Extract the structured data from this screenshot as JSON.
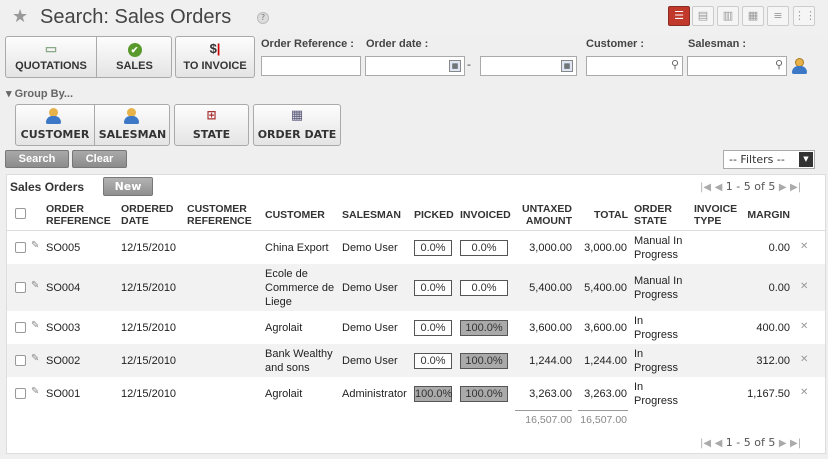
{
  "header": {
    "title": "Search: Sales Orders",
    "help": "?"
  },
  "views": [
    {
      "name": "list-view-icon",
      "glyph": "☰",
      "active": true
    },
    {
      "name": "page-view-icon",
      "glyph": "▤"
    },
    {
      "name": "graph-view-icon",
      "glyph": "▥"
    },
    {
      "name": "calendar-view-icon",
      "glyph": "▦"
    },
    {
      "name": "gantt-view-icon",
      "glyph": "≡"
    },
    {
      "name": "kanban-view-icon",
      "glyph": "⋮⋮"
    }
  ],
  "filters": {
    "quotations": "QUOTATIONS",
    "sales": "SALES",
    "to_invoice": "TO INVOICE",
    "customer": "CUSTOMER",
    "salesman": "SALESMAN",
    "state": "STATE",
    "order_date": "ORDER DATE"
  },
  "fields": {
    "order_reference": "Order Reference :",
    "order_date": "Order date :",
    "customer": "Customer :",
    "salesman": "Salesman :",
    "date_sep": "-"
  },
  "groupby_label": "▾ Group By...",
  "buttons": {
    "search": "Search",
    "clear": "Clear",
    "new": "New"
  },
  "filters_select": "-- Filters --",
  "list": {
    "title": "Sales Orders",
    "pager": "1 - 5 of 5",
    "columns": [
      "ORDER\nREFERENCE",
      "ORDERED\nDATE",
      "CUSTOMER\nREFERENCE",
      "CUSTOMER",
      "SALESMAN",
      "PICKED",
      "INVOICED",
      "UNTAXED\nAMOUNT",
      "TOTAL",
      "ORDER\nSTATE",
      "INVOICE\nTYPE",
      "MARGIN"
    ],
    "rows": [
      {
        "ref": "SO005",
        "date": "12/15/2010",
        "cref": "",
        "customer": "China Export",
        "salesman": "Demo User",
        "picked": "0.0%",
        "picked_pct": 0,
        "invoiced": "0.0%",
        "invoiced_pct": 0,
        "untaxed": "3,000.00",
        "total": "3,000.00",
        "state": "Manual In\nProgress",
        "itype": "",
        "margin": "0.00"
      },
      {
        "ref": "SO004",
        "date": "12/15/2010",
        "cref": "",
        "customer": "Ecole de\nCommerce de\nLiege",
        "salesman": "Demo User",
        "picked": "0.0%",
        "picked_pct": 0,
        "invoiced": "0.0%",
        "invoiced_pct": 0,
        "untaxed": "5,400.00",
        "total": "5,400.00",
        "state": "Manual In\nProgress",
        "itype": "",
        "margin": "0.00"
      },
      {
        "ref": "SO003",
        "date": "12/15/2010",
        "cref": "",
        "customer": "Agrolait",
        "salesman": "Demo User",
        "picked": "0.0%",
        "picked_pct": 0,
        "invoiced": "100.0%",
        "invoiced_pct": 100,
        "untaxed": "3,600.00",
        "total": "3,600.00",
        "state": "In\nProgress",
        "itype": "",
        "margin": "400.00"
      },
      {
        "ref": "SO002",
        "date": "12/15/2010",
        "cref": "",
        "customer": "Bank Wealthy\nand sons",
        "salesman": "Demo User",
        "picked": "0.0%",
        "picked_pct": 0,
        "invoiced": "100.0%",
        "invoiced_pct": 100,
        "untaxed": "1,244.00",
        "total": "1,244.00",
        "state": "In\nProgress",
        "itype": "",
        "margin": "312.00"
      },
      {
        "ref": "SO001",
        "date": "12/15/2010",
        "cref": "",
        "customer": "Agrolait",
        "salesman": "Administrator",
        "picked": "100.0%",
        "picked_pct": 100,
        "invoiced": "100.0%",
        "invoiced_pct": 100,
        "untaxed": "3,263.00",
        "total": "3,263.00",
        "state": "In\nProgress",
        "itype": "",
        "margin": "1,167.50"
      }
    ],
    "totals": {
      "untaxed": "16,507.00",
      "total": "16,507.00"
    }
  }
}
